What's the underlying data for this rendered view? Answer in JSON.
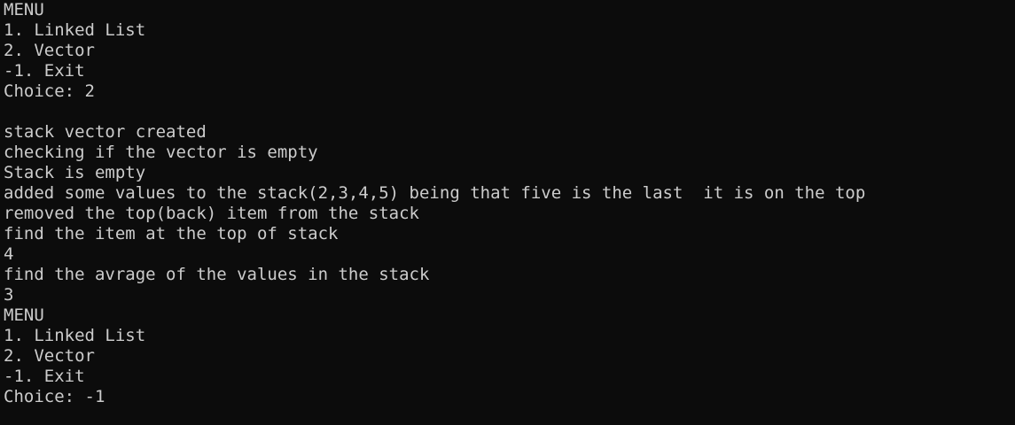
{
  "terminal": {
    "lines": [
      "MENU",
      "1. Linked List",
      "2. Vector",
      "-1. Exit",
      "Choice: 2",
      "",
      "stack vector created",
      "checking if the vector is empty",
      "Stack is empty",
      "added some values to the stack(2,3,4,5) being that five is the last  it is on the top",
      "removed the top(back) item from the stack",
      "find the item at the top of stack",
      "4",
      "find the avrage of the values in the stack",
      "3",
      "MENU",
      "1. Linked List",
      "2. Vector",
      "-1. Exit",
      "Choice: -1"
    ]
  },
  "colors": {
    "background": "#0c0c0c",
    "text": "#cccccc"
  }
}
